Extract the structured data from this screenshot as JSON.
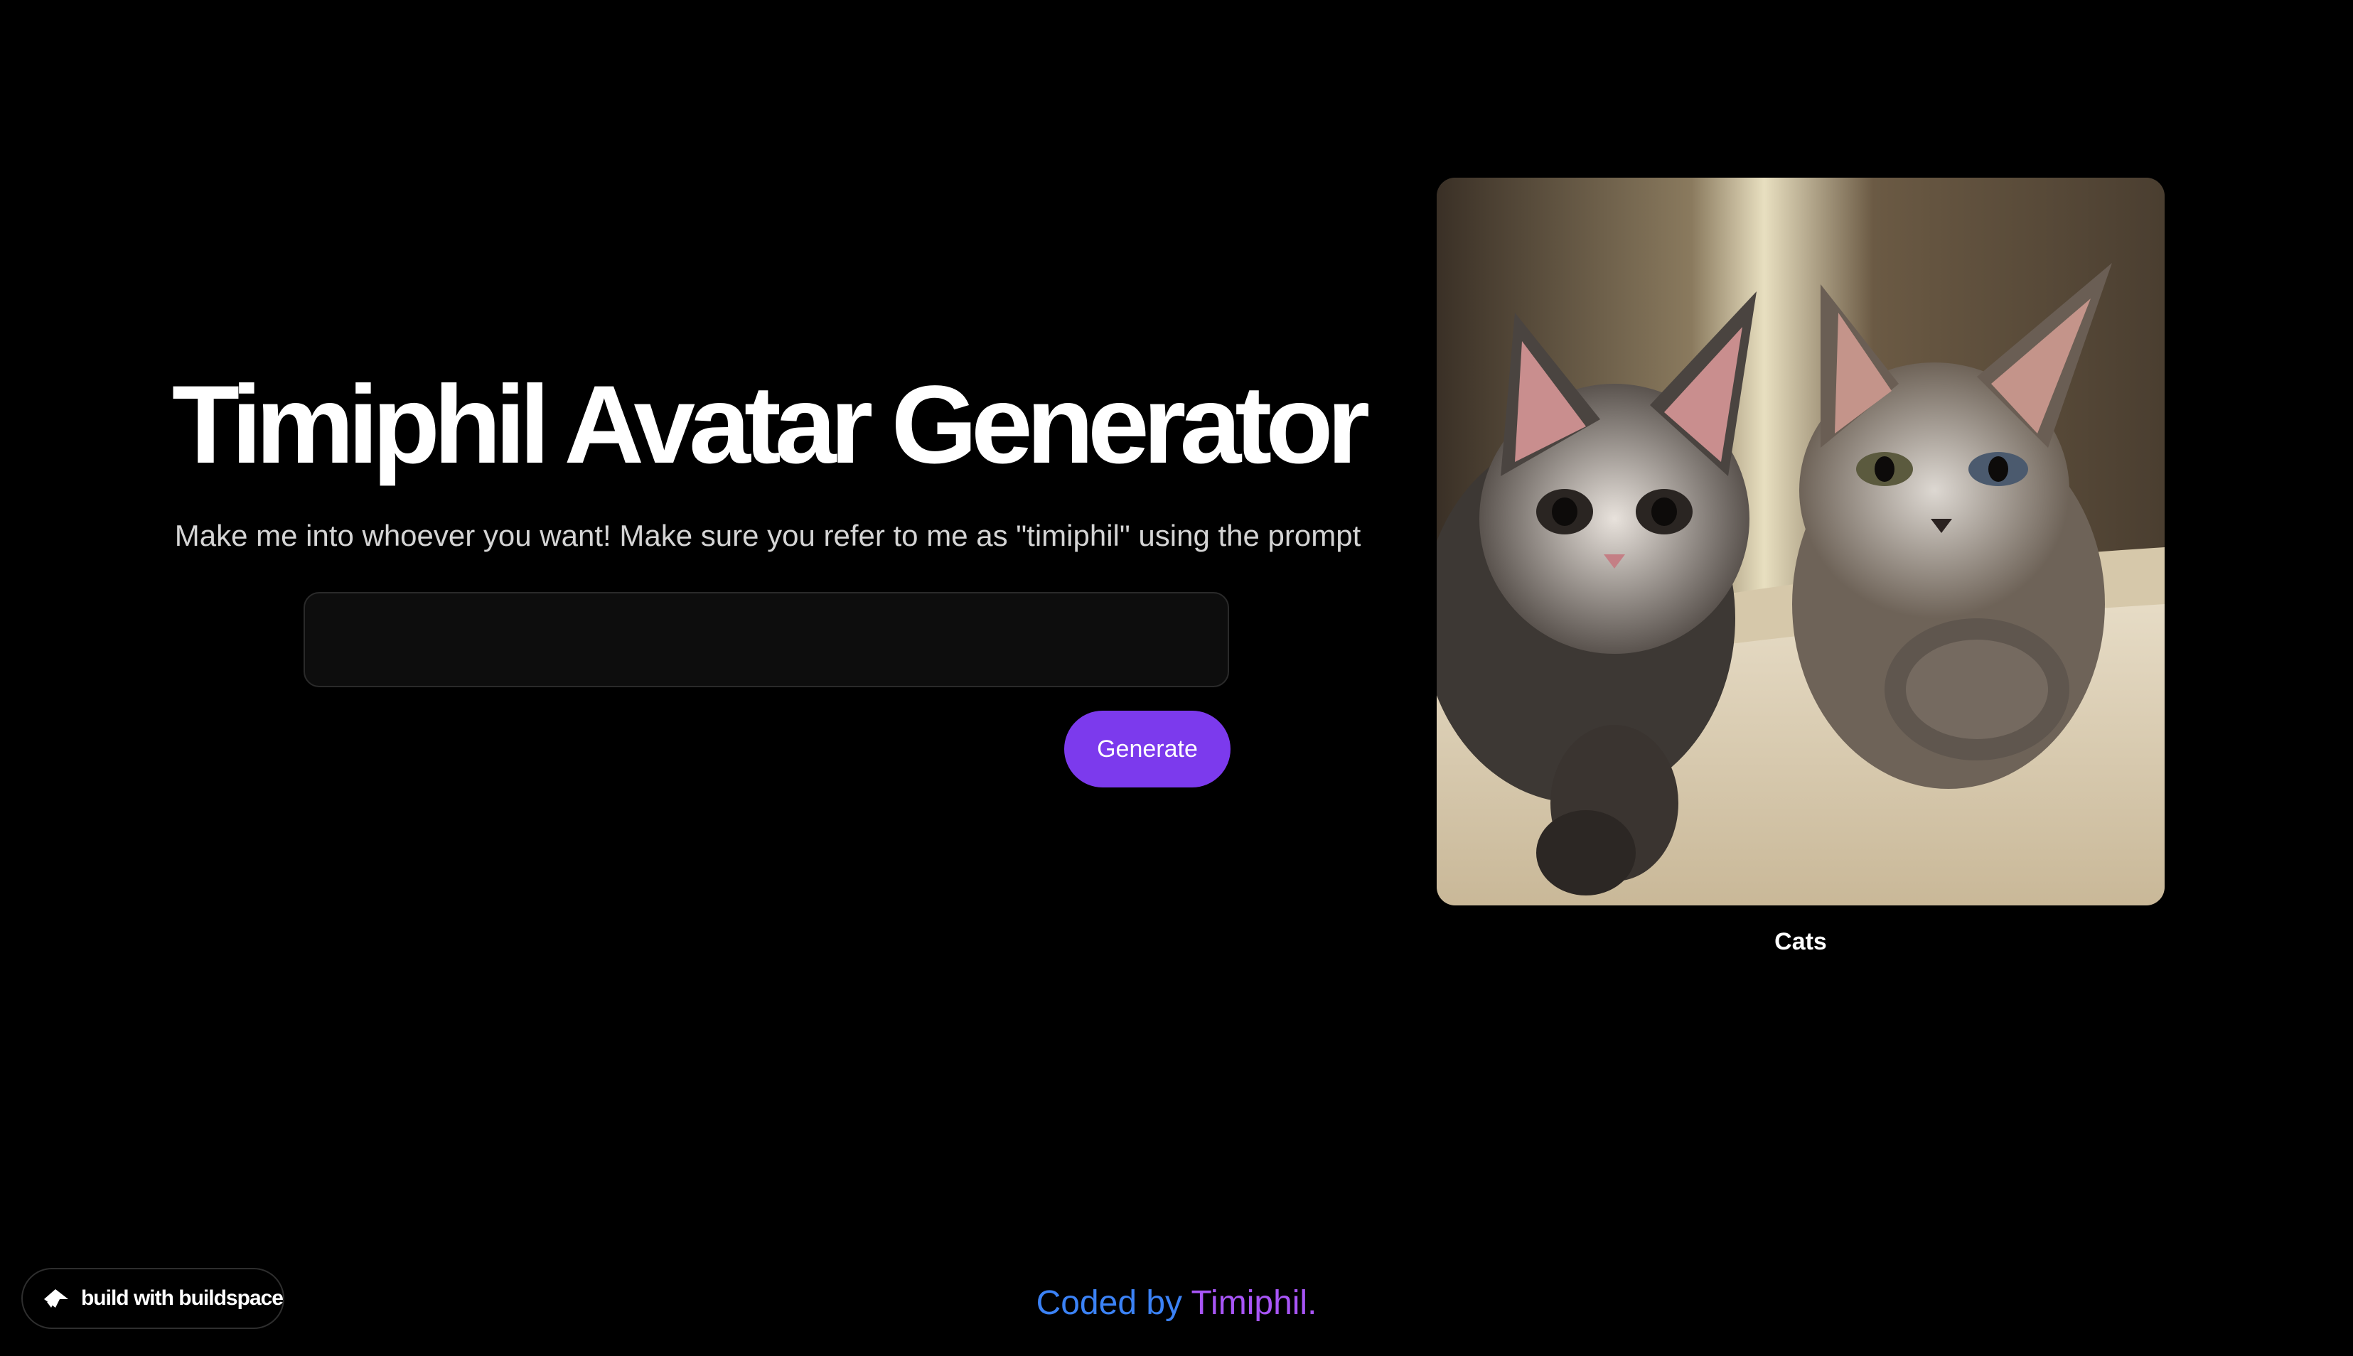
{
  "header": {
    "title": "Timiphil Avatar Generator",
    "subtitle": "Make me into whoever you want! Make sure you refer to me as \"timiphil\" using the prompt"
  },
  "prompt": {
    "value": "",
    "placeholder": ""
  },
  "actions": {
    "generate_label": "Generate"
  },
  "result": {
    "caption": "Cats"
  },
  "badge": {
    "icon": "buildspace-logo-icon",
    "label": "build with buildspace"
  },
  "footer": {
    "prefix": "Coded by ",
    "name": "Timiphil."
  },
  "colors": {
    "background": "#000000",
    "accent": "#7c3aed",
    "footer_blue": "#3b82f6",
    "footer_purple": "#a855f7"
  }
}
